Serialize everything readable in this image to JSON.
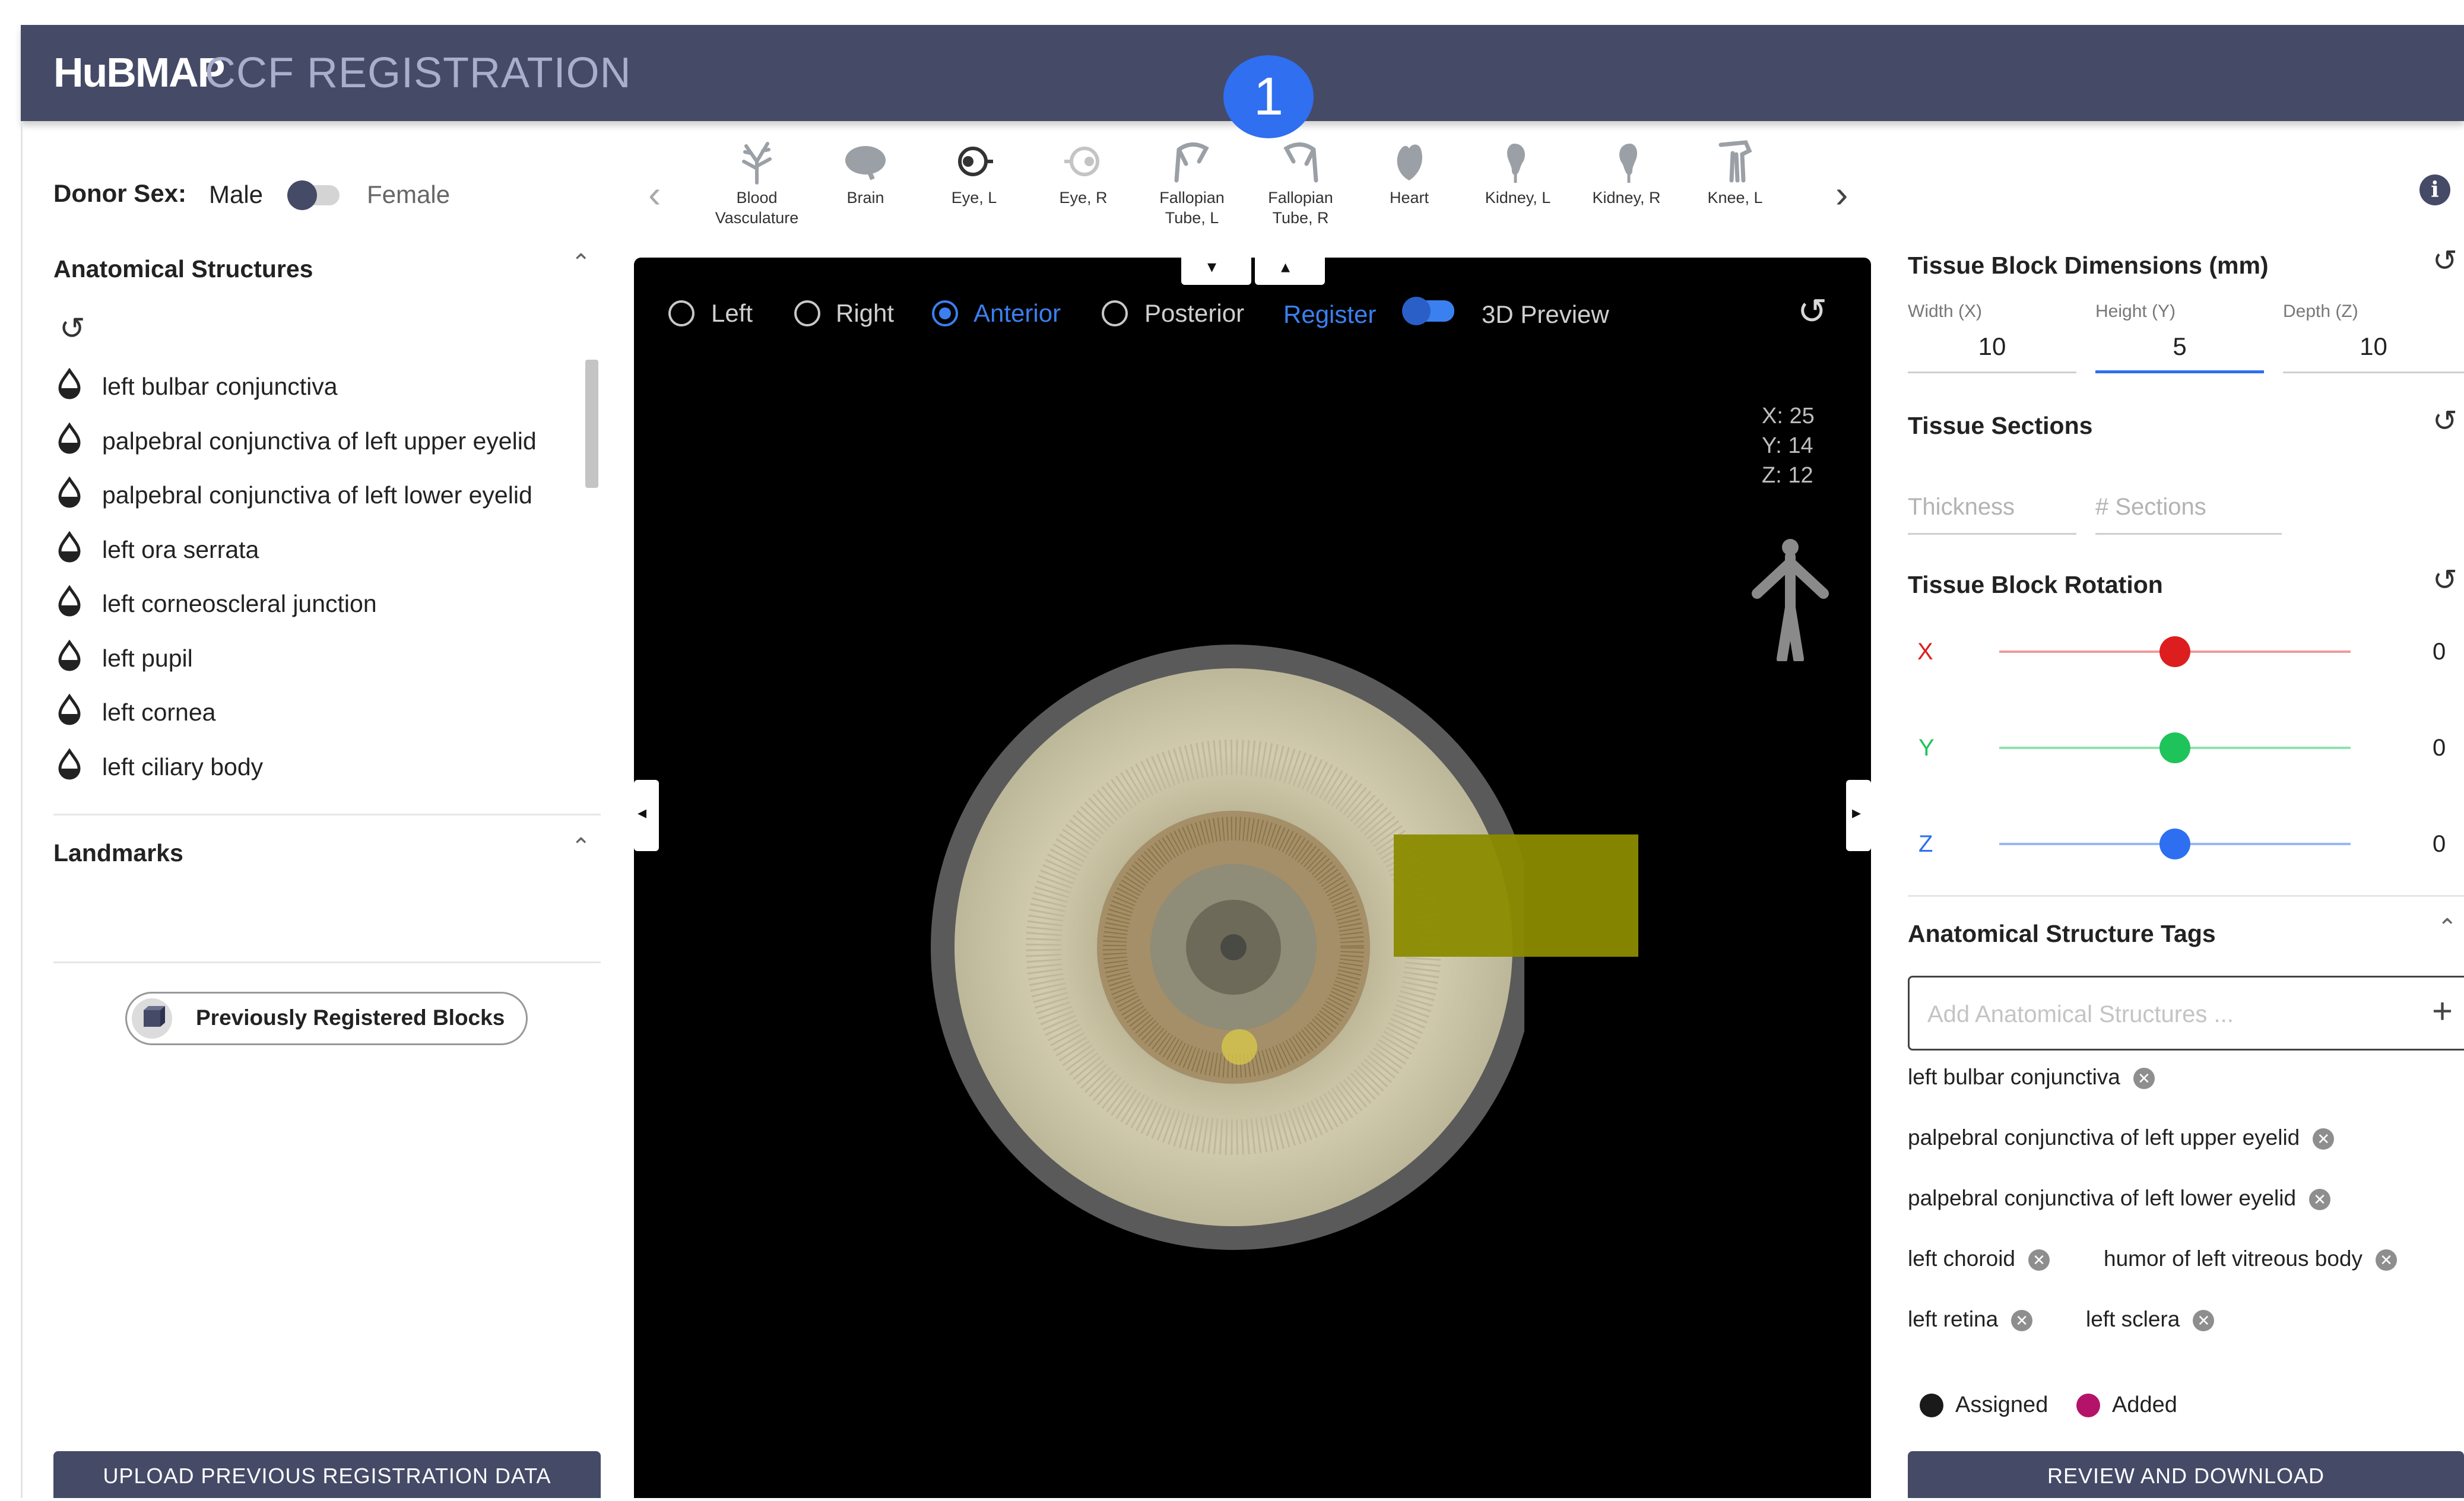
{
  "header": {
    "brand_bold": "HuBMAP",
    "brand_light": "CCF REGISTRATION",
    "step_number": "1"
  },
  "donor": {
    "label": "Donor Sex:",
    "male": "Male",
    "female": "Female",
    "selected": "Male"
  },
  "anatomical_structures": {
    "title": "Anatomical Structures",
    "items": [
      "left bulbar conjunctiva",
      "palpebral conjunctiva of left upper eyelid",
      "palpebral conjunctiva of left lower eyelid",
      "left ora serrata",
      "left corneoscleral junction",
      "left pupil",
      "left cornea",
      "left ciliary body"
    ]
  },
  "landmarks": {
    "title": "Landmarks"
  },
  "previously_registered_label": "Previously Registered Blocks",
  "upload_label": "UPLOAD PREVIOUS REGISTRATION DATA",
  "organs": [
    {
      "line1": "Blood",
      "line2": "Vasculature",
      "icon": "vasculature-icon"
    },
    {
      "line1": "Brain",
      "line2": "",
      "icon": "brain-icon"
    },
    {
      "line1": "Eye, L",
      "line2": "",
      "icon": "eye-icon"
    },
    {
      "line1": "Eye, R",
      "line2": "",
      "icon": "eye-icon"
    },
    {
      "line1": "Fallopian",
      "line2": "Tube, L",
      "icon": "fallopian-tube-icon"
    },
    {
      "line1": "Fallopian",
      "line2": "Tube, R",
      "icon": "fallopian-tube-icon"
    },
    {
      "line1": "Heart",
      "line2": "",
      "icon": "heart-icon"
    },
    {
      "line1": "Kidney, L",
      "line2": "",
      "icon": "kidney-icon"
    },
    {
      "line1": "Kidney, R",
      "line2": "",
      "icon": "kidney-icon"
    },
    {
      "line1": "Knee, L",
      "line2": "",
      "icon": "knee-icon"
    }
  ],
  "viewer": {
    "views": [
      "Left",
      "Right",
      "Anterior",
      "Posterior"
    ],
    "selected_view": "Anterior",
    "register_label": "Register",
    "preview_label": "3D Preview",
    "coords": {
      "x": "X: 25",
      "y": "Y: 14",
      "z": "Z: 12"
    }
  },
  "dimensions": {
    "title": "Tissue Block Dimensions (mm)",
    "width_label": "Width (X)",
    "width": "10",
    "height_label": "Height (Y)",
    "height": "5",
    "depth_label": "Depth (Z)",
    "depth": "10"
  },
  "sections": {
    "title": "Tissue Sections",
    "thickness_placeholder": "Thickness",
    "count_placeholder": "# Sections"
  },
  "rotation": {
    "title": "Tissue Block Rotation",
    "x_label": "X",
    "x_value": "0",
    "y_label": "Y",
    "y_value": "0",
    "z_label": "Z",
    "z_value": "0",
    "colors": {
      "x": "#dd1e1e",
      "y": "#1ec45a",
      "z": "#2d6ff0"
    }
  },
  "tags": {
    "title": "Anatomical Structure Tags",
    "placeholder": "Add Anatomical Structures ...",
    "items": [
      "left bulbar conjunctiva",
      "palpebral conjunctiva of left upper eyelid",
      "palpebral conjunctiva of left lower eyelid",
      "left choroid",
      "humor of left vitreous body",
      "left retina",
      "left sclera"
    ],
    "legend_assigned": "Assigned",
    "legend_added": "Added"
  },
  "review_label": "REVIEW AND DOWNLOAD"
}
